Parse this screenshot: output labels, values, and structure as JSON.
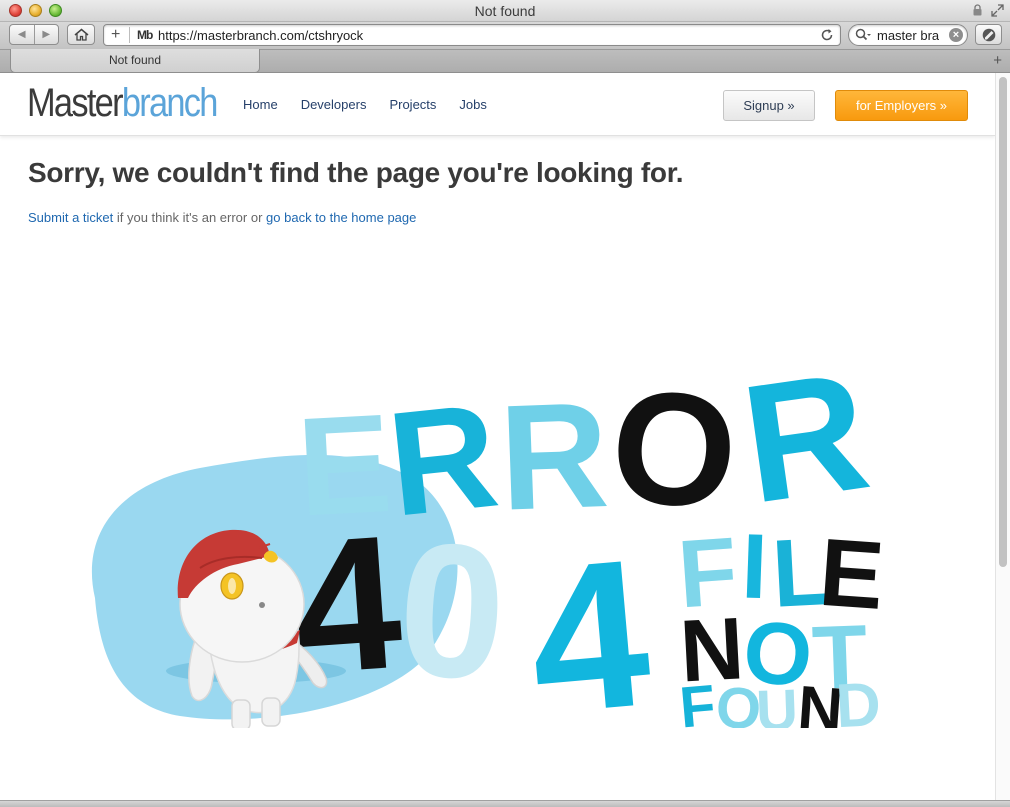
{
  "window": {
    "title": "Not found"
  },
  "toolbar": {
    "url": "https://masterbranch.com/ctshryock",
    "favicon_text": "Mb",
    "search_value": "master branch"
  },
  "tabs": [
    {
      "label": "Not found"
    }
  ],
  "site": {
    "logo_part1": "Master",
    "logo_part2": "branch",
    "nav": [
      "Home",
      "Developers",
      "Projects",
      "Jobs"
    ],
    "signup_label": "Signup »",
    "employers_label": "for Employers »"
  },
  "content": {
    "heading": "Sorry, we couldn't find the page you're looking for.",
    "link_ticket": "Submit a ticket",
    "middle_text": " if you think it's an error or ",
    "link_home": "go back to the home page"
  },
  "illustration": {
    "word_error": [
      "E",
      "R",
      "R",
      "O",
      "R"
    ],
    "code": [
      "4",
      "0",
      "4"
    ],
    "word_file": [
      "F",
      "I",
      "L",
      "E"
    ],
    "word_not": [
      "N",
      "O",
      "T"
    ],
    "word_found": [
      "F",
      "O",
      "U",
      "N",
      "D"
    ]
  },
  "colors": {
    "logo_accent": "#5ba4d9",
    "employers_button": "#f89a0e",
    "link": "#1f68b0",
    "illustration_blue": "#00b4dc",
    "illustration_light_blue": "#8fdcee",
    "blob": "#9ad8f0"
  }
}
